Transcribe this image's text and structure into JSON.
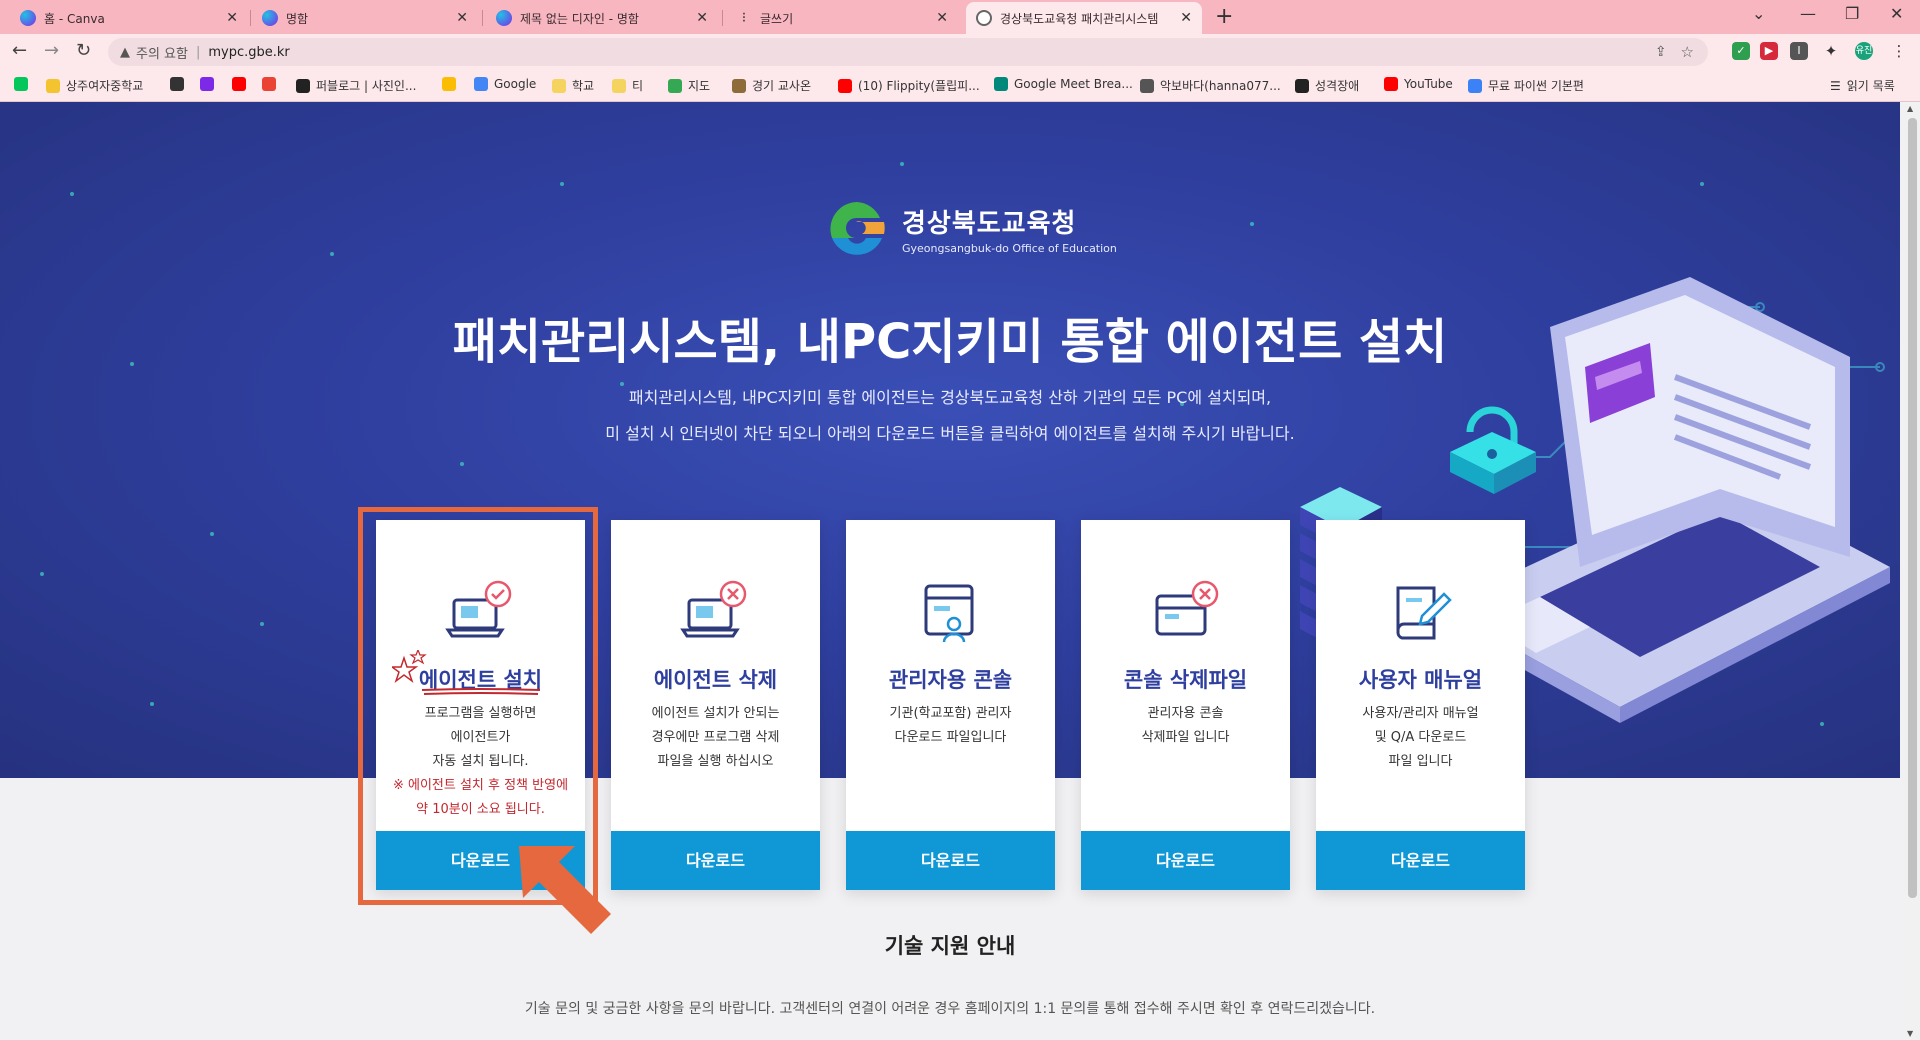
{
  "browser": {
    "tabs": [
      {
        "title": "홈 - Canva",
        "icon": "canva-icon"
      },
      {
        "title": "명함",
        "icon": "canva-icon"
      },
      {
        "title": "제목 없는 디자인 - 명함",
        "icon": "canva-icon"
      },
      {
        "title": "글쓰기",
        "icon": "vrew-icon"
      },
      {
        "title": "경상북도교육청 패치관리시스템",
        "icon": "globe-icon"
      }
    ],
    "security_label": "주의 요함",
    "url": "mypc.gbe.kr",
    "profile_label": "유진",
    "bookmarks": [
      {
        "label": "",
        "icon": "naver-icon",
        "color": "#03c75a"
      },
      {
        "label": "상주여자중학교",
        "icon": "school-icon",
        "color": "#f4c430"
      },
      {
        "label": "",
        "icon": "vrew-icon",
        "color": "#333333"
      },
      {
        "label": "",
        "icon": "canva-icon",
        "color": "#7d2ae8"
      },
      {
        "label": "",
        "icon": "youtube-icon",
        "color": "#ff0000"
      },
      {
        "label": "",
        "icon": "gmail-icon",
        "color": "#ea4335"
      },
      {
        "label": "퍼블로그 | 사진인...",
        "icon": "p-icon",
        "color": "#222222"
      },
      {
        "label": "",
        "icon": "drive-icon",
        "color": "#fbbc04"
      },
      {
        "label": "Google",
        "icon": "google-icon",
        "color": "#4285f4"
      },
      {
        "label": "학교",
        "icon": "folder-icon",
        "color": "#f4d35e"
      },
      {
        "label": "티",
        "icon": "folder-icon",
        "color": "#f4d35e"
      },
      {
        "label": "지도",
        "icon": "maps-icon",
        "color": "#34a853"
      },
      {
        "label": "경기 교사온",
        "icon": "teacher-icon",
        "color": "#8e6c3a"
      },
      {
        "label": "(10) Flippity(플립피...",
        "icon": "youtube-icon",
        "color": "#ff0000"
      },
      {
        "label": "Google Meet Brea...",
        "icon": "meet-icon",
        "color": "#00897b"
      },
      {
        "label": "악보바다(hanna077...",
        "icon": "music-icon",
        "color": "#555555"
      },
      {
        "label": "성격장애",
        "icon": "chatgpt-icon",
        "color": "#222222"
      },
      {
        "label": "YouTube",
        "icon": "youtube-icon",
        "color": "#ff0000"
      },
      {
        "label": "무료 파이썬 기본편",
        "icon": "python-icon",
        "color": "#3b82f6"
      }
    ],
    "reading_list": "읽기 목록"
  },
  "page": {
    "logo": {
      "ko": "경상북도교육청",
      "en": "Gyeongsangbuk-do Office of Education"
    },
    "title": "패치관리시스템, 내PC지키미 통합 에이전트 설치",
    "desc_line1": "패치관리시스템, 내PC지키미 통합 에이전트는 경상북도교육청 산하 기관의 모든 PC에 설치되며,",
    "desc_line2": "미 설치 시 인터넷이 차단 되오니 아래의 다운로드 버튼을 클릭하여 에이전트를 설치해 주시기 바랍니다.",
    "cards": [
      {
        "title": "에이전트 설치",
        "icon": "laptop-check-icon",
        "desc": [
          "프로그램을 실행하면",
          "에이전트가",
          "자동 설치 됩니다."
        ],
        "warn": [
          "※ 에이전트 설치 후 정책 반영에",
          "약 10분이 소요 됩니다."
        ],
        "button": "다운로드"
      },
      {
        "title": "에이전트 삭제",
        "icon": "laptop-x-icon",
        "desc": [
          "에이전트 설치가 안되는",
          "경우에만 프로그램 삭제",
          "파일을 실행 하십시오"
        ],
        "button": "다운로드"
      },
      {
        "title": "관리자용 콘솔",
        "icon": "admin-console-icon",
        "desc": [
          "기관(학교포함) 관리자",
          "다운로드 파일입니다"
        ],
        "button": "다운로드"
      },
      {
        "title": "콘솔 삭제파일",
        "icon": "card-x-icon",
        "desc": [
          "관리자용 콘솔",
          "삭제파일 입니다"
        ],
        "button": "다운로드"
      },
      {
        "title": "사용자 매뉴얼",
        "icon": "manual-book-icon",
        "desc": [
          "사용자/관리자 매뉴얼",
          "및 Q/A 다운로드",
          "파일 입니다"
        ],
        "button": "다운로드"
      }
    ],
    "support_title": "기술 지원 안내",
    "support_desc": "기술 문의 및 궁금한 사항을 문의 바랍니다. 고객센터의 연결이 어려운 경우 홈페이지의 1:1 문의를 통해 접수해 주시면 확인 후 연락드리겠습니다."
  },
  "colors": {
    "hero_bg": "#2f3f9f",
    "accent": "#0f97d6",
    "title": "#2f3f9f",
    "annotation": "#e5683f",
    "warn": "#c3282e"
  }
}
